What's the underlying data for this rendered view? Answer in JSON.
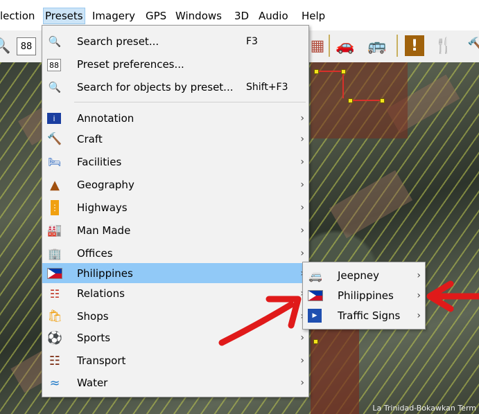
{
  "menubar": {
    "items": [
      "lection",
      "Presets",
      "Imagery",
      "GPS",
      "Windows",
      "3D",
      "Audio",
      "Help"
    ]
  },
  "toolbar": {
    "icons": [
      "search-icon",
      "preset-prefs-icon",
      "building-icon",
      "car-icon",
      "bus-icon",
      "warning-icon",
      "restaurant-icon",
      "tool-icon"
    ]
  },
  "presets_menu": {
    "top_items": [
      {
        "label": "Search preset...",
        "shortcut": "F3",
        "icon": "search-icon"
      },
      {
        "label": "Preset preferences...",
        "shortcut": "",
        "icon": "preferences-icon"
      },
      {
        "label": "Search for objects by preset...",
        "shortcut": "Shift+F3",
        "icon": "search-objects-icon"
      }
    ],
    "groups": [
      {
        "label": "Annotation",
        "icon": "annotation-icon"
      },
      {
        "label": "Craft",
        "icon": "craft-icon"
      },
      {
        "label": "Facilities",
        "icon": "facilities-icon"
      },
      {
        "label": "Geography",
        "icon": "geography-icon"
      },
      {
        "label": "Highways",
        "icon": "highways-icon"
      },
      {
        "label": "Man Made",
        "icon": "man-made-icon"
      },
      {
        "label": "Offices",
        "icon": "offices-icon"
      },
      {
        "label": "Philippines",
        "icon": "philippines-flag-icon"
      },
      {
        "label": "Relations",
        "icon": "relations-icon"
      },
      {
        "label": "Shops",
        "icon": "shops-icon"
      },
      {
        "label": "Sports",
        "icon": "sports-icon"
      },
      {
        "label": "Transport",
        "icon": "transport-icon"
      },
      {
        "label": "Water",
        "icon": "water-icon"
      }
    ],
    "highlighted": "Philippines"
  },
  "philippines_submenu": {
    "items": [
      {
        "label": "Jeepney",
        "icon": "jeepney-icon"
      },
      {
        "label": "Philippines",
        "icon": "philippines-flag-icon"
      },
      {
        "label": "Traffic Signs",
        "icon": "traffic-signs-icon"
      }
    ]
  },
  "map": {
    "label": "La Trinidad-Bokawkan Term"
  },
  "colors": {
    "menu_bg": "#f2f2f2",
    "highlight": "#91c9f7",
    "annotation_arrow": "#e01a1a",
    "way_line": "#d8302a",
    "node": "#f4e21c"
  }
}
